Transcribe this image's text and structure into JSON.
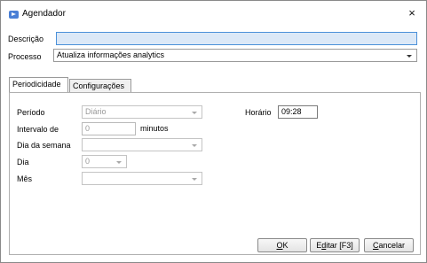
{
  "window": {
    "title": "Agendador",
    "close_glyph": "×"
  },
  "form": {
    "descricao_label": "Descrição",
    "descricao_value": "",
    "processo_label": "Processo",
    "processo_value": "Atualiza informações analytics"
  },
  "tabs": [
    {
      "label": "Periodicidade",
      "active": true
    },
    {
      "label": "Configurações",
      "active": false
    }
  ],
  "periodicidade": {
    "periodo_label": "Período",
    "periodo_value": "Diário",
    "intervalo_label": "Intervalo de",
    "intervalo_value": "0",
    "intervalo_unit": "minutos",
    "dia_semana_label": "Dia da semana",
    "dia_semana_value": "",
    "dia_label": "Dia",
    "dia_value": "0",
    "mes_label": "Mês",
    "mes_value": "",
    "horario_label": "Horário",
    "horario_value": "09:28"
  },
  "buttons": {
    "ok_hotkey": "O",
    "ok_rest": "K",
    "editar_pre": "E",
    "editar_hotkey": "d",
    "editar_rest": "itar [F3]",
    "cancelar_hotkey": "C",
    "cancelar_rest": "ancelar"
  },
  "icons": {
    "app": "scheduler-app-icon",
    "close": "close-icon",
    "dropdown": "chevron-down-icon"
  },
  "colors": {
    "accent": "#4a7fd6",
    "focus_fill": "#dbe8f7",
    "focus_border": "#4a90d9"
  }
}
